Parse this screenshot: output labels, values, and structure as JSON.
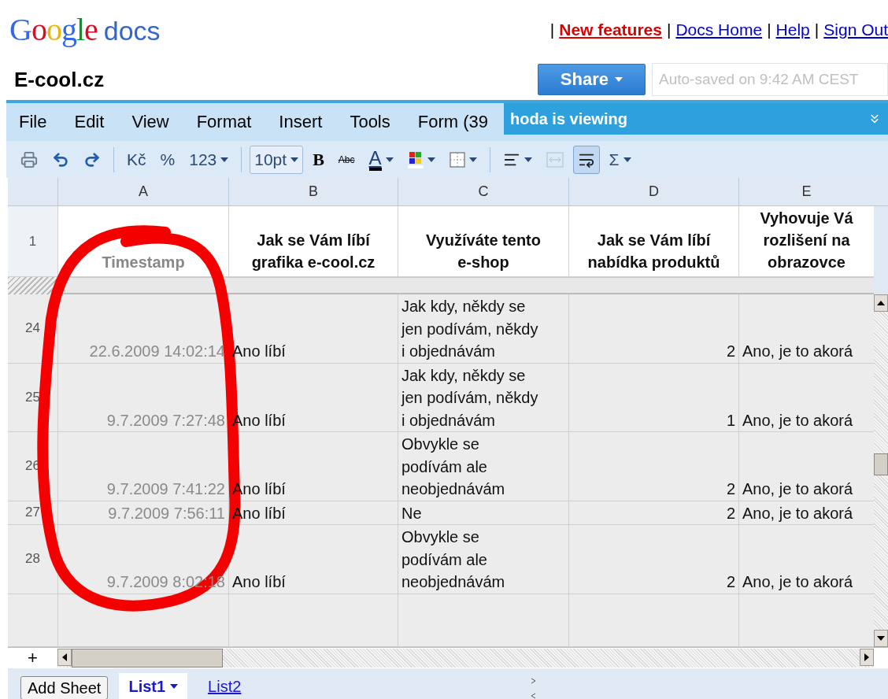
{
  "header": {
    "logo_brand": "Google",
    "logo_product": "docs",
    "separator": "|",
    "links": [
      {
        "label": "New features",
        "highlight": true
      },
      {
        "label": "Docs Home",
        "highlight": false
      },
      {
        "label": "Help",
        "highlight": false
      },
      {
        "label": "Sign Out",
        "highlight": false
      }
    ]
  },
  "document": {
    "title": "E-cool.cz",
    "share_label": "Share",
    "autosave": "Auto-saved on 9:42 AM CEST"
  },
  "menu": [
    "File",
    "Edit",
    "View",
    "Format",
    "Insert",
    "Tools",
    "Form (39"
  ],
  "viewing_banner": "hoda is viewing",
  "toolbar": [
    {
      "kind": "print",
      "pressed": false,
      "disabled": false
    },
    {
      "kind": "undo",
      "pressed": false,
      "disabled": false
    },
    {
      "kind": "redo",
      "pressed": false,
      "disabled": false
    },
    {
      "kind": "separator"
    },
    {
      "kind": "text",
      "label": "Kč",
      "pressed": false,
      "disabled": false
    },
    {
      "kind": "text",
      "label": "%",
      "pressed": false,
      "disabled": false
    },
    {
      "kind": "dropdown",
      "label": "123",
      "pressed": false,
      "disabled": false
    },
    {
      "kind": "separator"
    },
    {
      "kind": "fontsize",
      "label": "10pt",
      "pressed": false,
      "disabled": false
    },
    {
      "kind": "bold",
      "label": "B",
      "pressed": false,
      "disabled": false
    },
    {
      "kind": "strike",
      "label": "Abc",
      "pressed": false,
      "disabled": false
    },
    {
      "kind": "textcolor",
      "label": "A",
      "pressed": false,
      "disabled": false
    },
    {
      "kind": "fill",
      "pressed": false,
      "disabled": false
    },
    {
      "kind": "borders",
      "pressed": false,
      "disabled": false
    },
    {
      "kind": "separator"
    },
    {
      "kind": "align",
      "pressed": false,
      "disabled": false
    },
    {
      "kind": "merge",
      "pressed": false,
      "disabled": true
    },
    {
      "kind": "wrap",
      "pressed": true,
      "disabled": false
    },
    {
      "kind": "dropdown",
      "label": "Σ",
      "pressed": false,
      "disabled": false
    }
  ],
  "sheet": {
    "columns": [
      "A",
      "B",
      "C",
      "D",
      "E"
    ],
    "header_row": {
      "label": "1",
      "cells": [
        [
          "Timestamp"
        ],
        [
          "Jak se Vám líbí",
          "grafika e-cool.cz"
        ],
        [
          "Využíváte tento",
          "e-shop"
        ],
        [
          "Jak se Vám líbí",
          "nabídka produktů"
        ],
        [
          "Vyhovuje Vá",
          "rozlišení na",
          "obrazovce"
        ]
      ]
    },
    "rows": [
      {
        "label": "24",
        "cells": [
          [
            "22.6.2009 14:02:14"
          ],
          [
            "Ano líbí"
          ],
          [
            "Jak kdy, někdy se",
            "jen podívám, někdy",
            "i objednávám"
          ],
          [
            "2"
          ],
          [
            "Ano, je to akorá"
          ]
        ]
      },
      {
        "label": "25",
        "cells": [
          [
            "9.7.2009 7:27:48"
          ],
          [
            "Ano líbí"
          ],
          [
            "Jak kdy, někdy se",
            "jen podívám, někdy",
            "i objednávám"
          ],
          [
            "1"
          ],
          [
            "Ano, je to akorá"
          ]
        ]
      },
      {
        "label": "26",
        "cells": [
          [
            "9.7.2009 7:41:22"
          ],
          [
            "Ano líbí"
          ],
          [
            "Obvykle se",
            "podívám ale",
            "neobjednávám"
          ],
          [
            "2"
          ],
          [
            "Ano, je to akorá"
          ]
        ]
      },
      {
        "label": "27",
        "cells": [
          [
            "9.7.2009 7:56:11"
          ],
          [
            "Ano líbí"
          ],
          [
            "Ne"
          ],
          [
            "2"
          ],
          [
            "Ano, je to akorá"
          ]
        ]
      },
      {
        "label": "28",
        "cells": [
          [
            "9.7.2009 8:02:18"
          ],
          [
            "Ano líbí"
          ],
          [
            "Obvykle se",
            "podívám ale",
            "neobjednávám"
          ],
          [
            "2"
          ],
          [
            "Ano, je to akorá"
          ]
        ]
      }
    ],
    "add_row": "+"
  },
  "sheet_tabs": {
    "add_label": "Add Sheet",
    "tabs": [
      {
        "label": "List1",
        "selected": true
      },
      {
        "label": "List2",
        "selected": false
      }
    ]
  }
}
